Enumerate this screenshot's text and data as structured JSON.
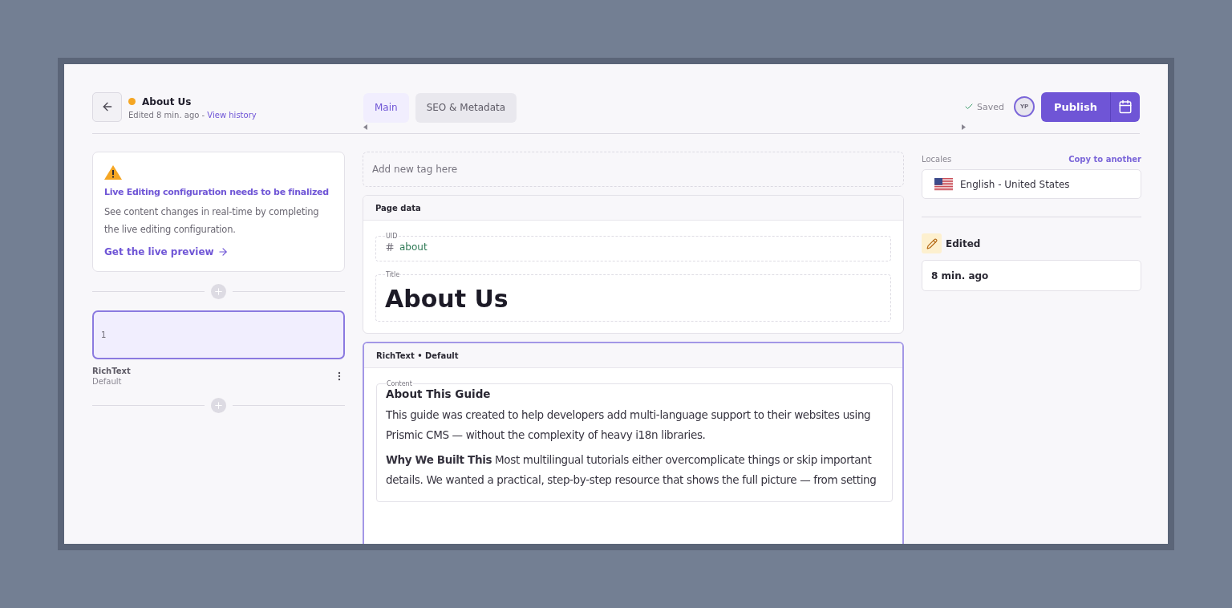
{
  "header": {
    "title": "About Us",
    "edited": "Edited 8 min. ago - ",
    "history_link": "View history"
  },
  "tabs": [
    {
      "label": "Main",
      "selected": true
    },
    {
      "label": "SEO & Metadata",
      "selected": false
    }
  ],
  "status": {
    "saved": "Saved",
    "avatar": "YP",
    "publish": "Publish"
  },
  "alert": {
    "title": "Live Editing configuration needs to be finalized",
    "body": "See content changes in real-time by completing the live editing configuration.",
    "link": "Get the live preview"
  },
  "slices": [
    {
      "index": "1",
      "name": "RichText",
      "variation": "Default",
      "selected": true
    }
  ],
  "tag_field": {
    "placeholder": "Add new tag here"
  },
  "page_data": {
    "title": "Page data",
    "uid_label": "UID",
    "uid": "about",
    "title_label": "Title",
    "title_value": "About Us"
  },
  "rich_text": {
    "title": "RichText • Default",
    "selected": true,
    "content_label": "Content",
    "heading": "About This Guide",
    "paragraphs": [
      "This guide was created to help developers add multi-language support to their websites using Prismic CMS — without the complexity of heavy i18n libraries.",
      "**Why We Built This** Most multilingual tutorials either overcomplicate things or skip important details. We wanted a practical, step-by-step resource that shows the full picture — from setting"
    ]
  },
  "locales": {
    "label": "Locales",
    "copy_link": "Copy to another",
    "locale": "English - United States"
  },
  "edited": {
    "label": "Edited",
    "time": "8 min. ago"
  }
}
